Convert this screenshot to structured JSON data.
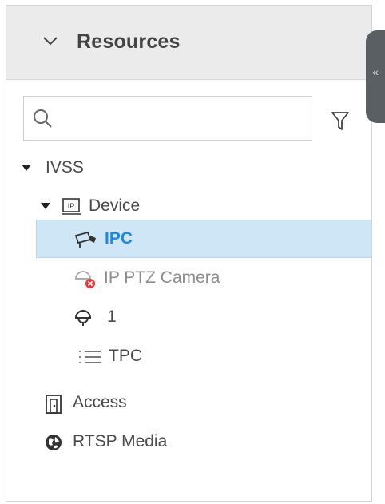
{
  "header": {
    "title": "Resources"
  },
  "collapse": {
    "glyph": "«"
  },
  "search": {
    "placeholder": ""
  },
  "tree": {
    "root": {
      "label": "IVSS"
    },
    "device": {
      "label": "Device"
    },
    "children": [
      {
        "label": "IPC",
        "icon": "bullet-camera-icon",
        "selected": true
      },
      {
        "label": "IP PTZ Camera",
        "icon": "ptz-camera-offline-icon",
        "selected": false
      },
      {
        "label": "1",
        "icon": "dome-camera-icon",
        "selected": false
      },
      {
        "label": "TPC",
        "icon": "list-icon",
        "selected": false
      }
    ],
    "access": {
      "label": "Access",
      "icon": "door-icon"
    },
    "rtsp": {
      "label": "RTSP Media",
      "icon": "globe-icon"
    }
  },
  "colors": {
    "selected_bg": "#cfe6f6",
    "selected_text": "#1e88e5",
    "header_bg": "#ebebeb"
  }
}
